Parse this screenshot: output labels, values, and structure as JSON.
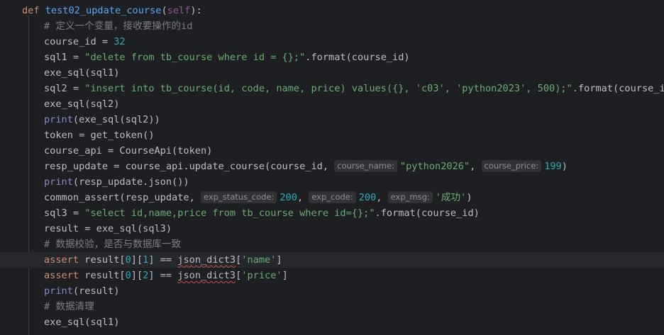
{
  "code": {
    "def_keyword": "def",
    "func_name": "test02_update_course",
    "self_param": "self",
    "comment_define": "# 定义一个变量，接收要操作的id",
    "course_id_value": "32",
    "sql1_string": "\"delete from tb_course where id = {};\"",
    "sql2_string": "\"insert into tb_course(id, code, name, price) values({}, 'c03', 'python2023', 500);\"",
    "print_name": "print",
    "resp_update_course_name_hint": "course_name:",
    "resp_update_course_name_value": "\"python2026\"",
    "resp_update_course_price_hint": "course_price:",
    "resp_update_course_price_value": "199",
    "assert_status_hint": "exp_status_code:",
    "assert_status_value": "200",
    "assert_code_hint": "exp_code:",
    "assert_code_value": "200",
    "assert_msg_hint": "exp_msg:",
    "assert_msg_value": "'成功'",
    "sql3_string": "\"select id,name,price from tb_course where id={};\"",
    "comment_verify": "# 数据校验，是否与数据库一致",
    "assert_keyword": "assert",
    "index_0": "0",
    "index_1": "1",
    "index_2": "2",
    "key_name": "'name'",
    "key_price": "'price'",
    "comment_cleanup": "# 数据清理"
  }
}
